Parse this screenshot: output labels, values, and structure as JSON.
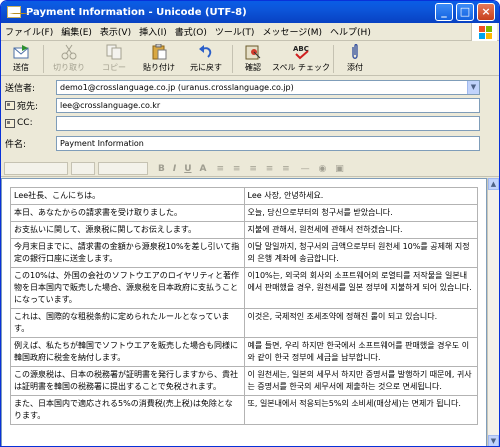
{
  "window": {
    "title": "Payment Information - Unicode (UTF-8)"
  },
  "title_buttons": {
    "minimize": "_",
    "maximize": "□",
    "close": "×"
  },
  "menu": [
    "ファイル(F)",
    "編集(E)",
    "表示(V)",
    "挿入(I)",
    "書式(O)",
    "ツール(T)",
    "メッセージ(M)",
    "ヘルプ(H)"
  ],
  "toolbar": {
    "send": "送信",
    "cut": "切り取り",
    "copy": "コピー",
    "paste": "貼り付け",
    "undo": "元に戻す",
    "check": "確認",
    "spell": "スペル チェック",
    "attach": "添付"
  },
  "headers": {
    "from_label": "送信者:",
    "from_value": "demo1@crosslanguage.co.jp     (uranus.crosslanguage.co.jp)",
    "to_label": "宛先:",
    "to_value": "lee@crosslanguage.co.kr",
    "cc_label": "CC:",
    "cc_value": "",
    "subject_label": "件名:",
    "subject_value": "Payment Information"
  },
  "format_bar": {
    "bold": "B",
    "italic": "I",
    "underline": "U",
    "color": "A"
  },
  "colors": {
    "title_blue": "#0a5de6",
    "border_blue": "#7f9db9",
    "chrome": "#ece9d8"
  },
  "rows": [
    {
      "ja": "Lee社長、こんにちは。",
      "ko": "Lee 사장, 안녕하세요."
    },
    {
      "ja": "本日、あなたからの請求書を受け取りました。",
      "ko": "오늘, 당신으로부터의 청구서를 받았습니다."
    },
    {
      "ja": "お支払いに関して、源泉税に関してお伝えします。",
      "ko": "지불에 관해서, 원천세에 관해서 전하겠습니다."
    },
    {
      "ja": "今月末日までに、請求書の金額から源泉税10%を差し引いて指定の銀行口座に送金します。",
      "ko": "이달 말일까지, 청구서의 금액으로부터 원천세 10%를 공제해 지정의 은행 계좌에 송금합니다."
    },
    {
      "ja": "この10%は、外国の会社のソフトウエアのロイヤリティと著作物を日本国内で販売した場合、源泉税を日本政府に支払うことになっています。",
      "ko": "이10%는, 외국의 회사의 소프트웨어의 로열티를 저작물을 일본내에서 판매했을 경우, 원천세를 일본 정부에 지불하게 되어 있습니다."
    },
    {
      "ja": "これは、国際的な租税条約に定められたルールとなっています。",
      "ko": "이것은, 국제적인 조세조약에 정해진 룰이 되고 있습니다."
    },
    {
      "ja": "例えば、私たちが韓国でソフトウエアを販売した場合も同様に韓国政府に税金を納付します。",
      "ko": "예를 들면, 우리 하지만 한국에서 소프트웨어를 판매했을 경우도 이와 같이 한국 정부에 세금을 납부합니다."
    },
    {
      "ja": "この源泉税は、日本の税務署が証明書を発行しますから、貴社は証明書を韓国の税務署に提出することで免税されます。",
      "ko": "이 원천세는, 일본의 세무서 하지만 증명서를 발행하기 때문에, 귀사는 증명서를 한국의 세무서에 제출하는 것으로 면세됩니다."
    },
    {
      "ja": "また、日本国内で適応される5%の消費税(売上税)は免除となります。",
      "ko": "또, 일본내에서 적응되는5%의 소비세(매상세)는 면제가 됩니다."
    }
  ]
}
